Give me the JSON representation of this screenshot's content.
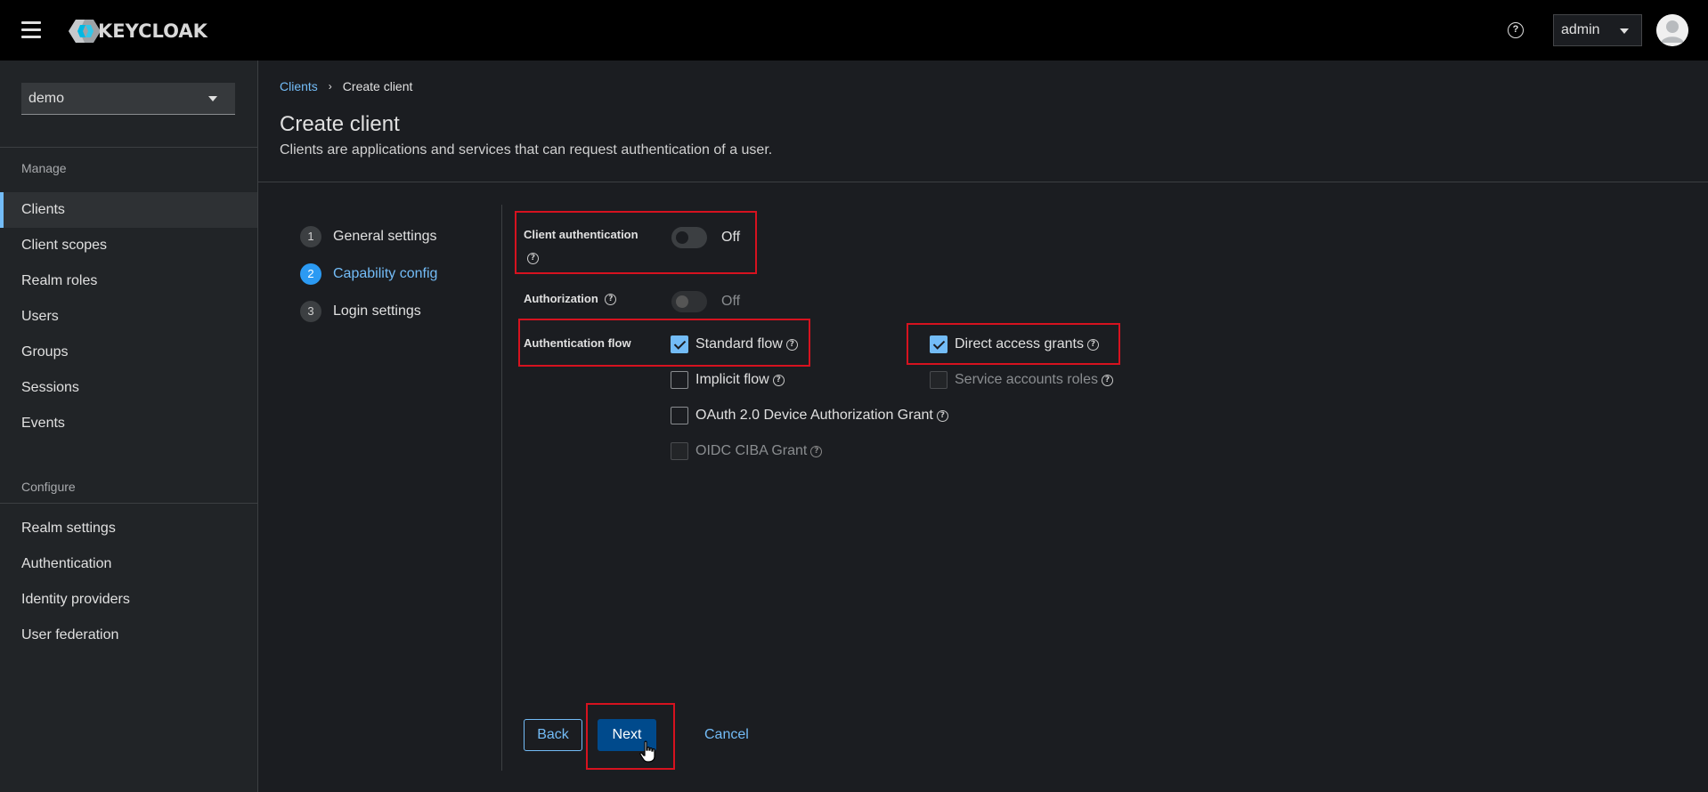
{
  "masthead": {
    "brand": "KEYCLOAK",
    "help_icon": "?",
    "user_menu": "admin",
    "icons": [
      "hamburger-menu-icon",
      "keycloak-logo-icon",
      "help-icon",
      "caret-down-icon",
      "user-avatar-icon"
    ]
  },
  "sidebar": {
    "realm": "demo",
    "manage_heading": "Manage",
    "manage_items": [
      "Clients",
      "Client scopes",
      "Realm roles",
      "Users",
      "Groups",
      "Sessions",
      "Events"
    ],
    "configure_heading": "Configure",
    "configure_items": [
      "Realm settings",
      "Authentication",
      "Identity providers",
      "User federation"
    ],
    "active_item": "Clients"
  },
  "breadcrumb": {
    "parent": "Clients",
    "separator": "›",
    "current": "Create client"
  },
  "page": {
    "title": "Create client",
    "description": "Clients are applications and services that can request authentication of a user."
  },
  "wizard": {
    "steps": [
      {
        "num": "1",
        "label": "General settings"
      },
      {
        "num": "2",
        "label": "Capability config"
      },
      {
        "num": "3",
        "label": "Login settings"
      }
    ],
    "current_step": 2
  },
  "form": {
    "client_auth": {
      "label": "Client authentication",
      "help": "?",
      "state": "Off"
    },
    "authorization": {
      "label": "Authorization",
      "help": "?",
      "state": "Off",
      "disabled": true
    },
    "auth_flow": {
      "label": "Authentication flow",
      "options": [
        {
          "label": "Standard flow",
          "checked": true,
          "disabled": false
        },
        {
          "label": "Direct access grants",
          "checked": true,
          "disabled": false
        },
        {
          "label": "Implicit flow",
          "checked": false,
          "disabled": false
        },
        {
          "label": "Service accounts roles",
          "checked": false,
          "disabled": true
        },
        {
          "label": "OAuth 2.0 Device Authorization Grant",
          "checked": false,
          "disabled": false
        },
        {
          "label": "OIDC CIBA Grant",
          "checked": false,
          "disabled": true
        }
      ],
      "help": "?"
    }
  },
  "footer": {
    "back": "Back",
    "next": "Next",
    "cancel": "Cancel"
  },
  "colors": {
    "accent": "#73bcf7",
    "primary_button": "#004a8c",
    "highlight_box": "#d6121f",
    "background": "#1b1d21"
  }
}
